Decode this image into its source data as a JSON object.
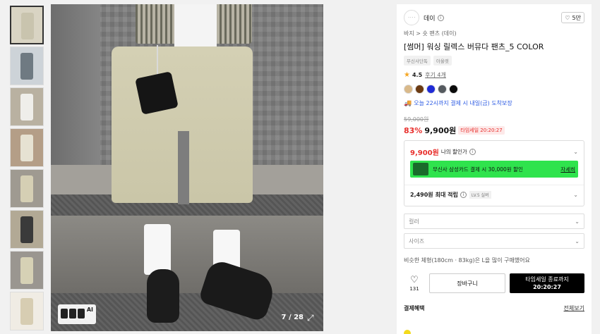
{
  "gallery": {
    "counter": "7 / 28",
    "ai_label": "AI",
    "thumbnails": [
      {
        "bg": "#d9d4c3",
        "fig": "#c9c4ae"
      },
      {
        "bg": "#cdd3d8",
        "fig": "#6f7a82"
      },
      {
        "bg": "#b9b1a1",
        "fig": "#efeeea"
      },
      {
        "bg": "#b49e87",
        "fig": "#e6e2d2"
      },
      {
        "bg": "#9f9a91",
        "fig": "#d5cfb4"
      },
      {
        "bg": "#b2a995",
        "fig": "#3a3a3a"
      },
      {
        "bg": "#9a9690",
        "fig": "#d6d1b5"
      },
      {
        "bg": "#f0ece4",
        "fig": "#d7cdb2"
      }
    ]
  },
  "product": {
    "brand_logo_text": "· · · ·",
    "brand": "데이",
    "like_count": "5만",
    "breadcrumb": "바지 > 숏 팬츠 (데이)",
    "title": "[썸머] 워싱 릴렉스 버뮤다 팬츠_5 COLOR",
    "tags": [
      "무신사단독",
      "아울렛"
    ],
    "rating": "4.5",
    "reviews": "후기 4개",
    "swatches": [
      "#d9b98a",
      "#6b3a12",
      "#1f2bd6",
      "#555a5f",
      "#0a0a0a"
    ],
    "delivery": "오늘 22시까지 결제 시 내일(금) 도착보장",
    "original_price": "59,000원",
    "discount": "83%",
    "price": "9,900원",
    "timesale": "타임세일 20:20:27"
  },
  "benefits": {
    "my_price": "9,900원",
    "my_price_label": "나의 할인가",
    "card_text": "무신사 삼성카드 결제 시 30,000원 할인",
    "card_link": "자세히",
    "points": "2,490원",
    "points_label": "최대 적립",
    "level_tag": "LV.5 실버"
  },
  "options": {
    "color_placeholder": "컬러",
    "size_placeholder": "사이즈",
    "size_tip": "비슷한 체형(180cm · 83kg)은 L을 많이 구매했어요"
  },
  "actions": {
    "heart_count": "131",
    "cart_label": "장바구니",
    "buy_label": "타임세일 종료까지",
    "buy_time": "20:20:27"
  },
  "payment": {
    "title": "결제혜택",
    "link": "전체보기"
  }
}
